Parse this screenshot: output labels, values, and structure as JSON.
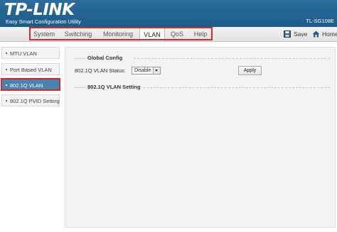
{
  "header": {
    "logo": "TP-LINK",
    "subtitle": "Easy Smart Configuration Utility",
    "model": "TL-SG108E"
  },
  "nav": {
    "tabs": [
      {
        "label": "System"
      },
      {
        "label": "Switching"
      },
      {
        "label": "Monitoring"
      },
      {
        "label": "VLAN"
      },
      {
        "label": "QoS"
      },
      {
        "label": "Help"
      }
    ],
    "active_tab": "VLAN",
    "save_label": "Save",
    "home_label": "Home"
  },
  "sidebar": {
    "items": [
      {
        "label": "MTU VLAN"
      },
      {
        "label": "Port Based VLAN"
      },
      {
        "label": "802.1Q VLAN"
      },
      {
        "label": "802.1Q PVID Setting"
      }
    ],
    "active_item": "802.1Q VLAN"
  },
  "main": {
    "global_config_title": "Global Config",
    "vlan_status_label": "802.1Q VLAN Status:",
    "vlan_status_value": "Disable",
    "apply_label": "Apply",
    "vlan_setting_title": "802.1Q VLAN Setting"
  },
  "colors": {
    "header_blue": "#1d5b8a",
    "active_sidebar": "#4a82b0",
    "highlight_red": "#d42a2a"
  }
}
